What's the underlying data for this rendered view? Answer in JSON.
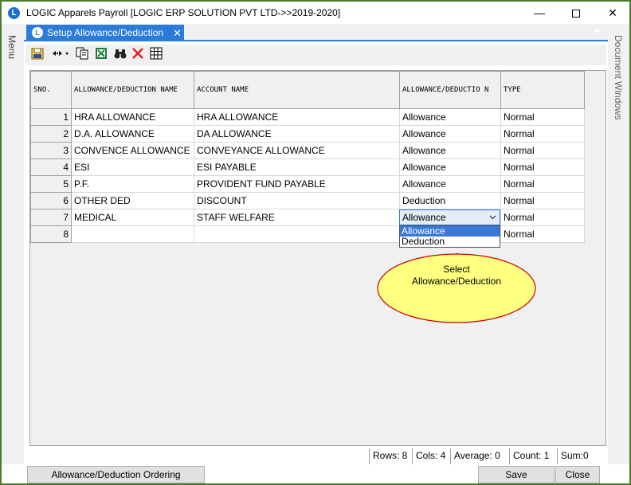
{
  "window": {
    "title": "LOGIC Apparels Payroll  [LOGIC ERP SOLUTION PVT LTD->>2019-2020]",
    "logo": "L",
    "min_label": "—",
    "close_label": "✕"
  },
  "left_panel": {
    "label": "Menu"
  },
  "right_panel": {
    "label": "Document Windows"
  },
  "tab": {
    "label": "Setup Allowance/Deduction",
    "close": "✕",
    "icon": "L"
  },
  "toolbar": {
    "icons": [
      "save-icon",
      "column-width-icon",
      "copy-icon",
      "excel-export-icon",
      "find-icon",
      "delete-icon",
      "grid-icon"
    ]
  },
  "grid": {
    "headers": {
      "sno": "SNO.",
      "name": "ALLOWANCE/DEDUCTION NAME",
      "account": "ACCOUNT NAME",
      "allowance": "ALLOWANCE/DEDUCTIO N",
      "type": "TYPE"
    },
    "rows": [
      {
        "sno": "1",
        "name": "HRA ALLOWANCE",
        "account": "HRA ALLOWANCE",
        "allowance": "Allowance",
        "type": "Normal"
      },
      {
        "sno": "2",
        "name": "D.A. ALLOWANCE",
        "account": "DA ALLOWANCE",
        "allowance": "Allowance",
        "type": "Normal"
      },
      {
        "sno": "3",
        "name": "CONVENCE ALLOWANCE",
        "account": "CONVEYANCE ALLOWANCE",
        "allowance": "Allowance",
        "type": "Normal"
      },
      {
        "sno": "4",
        "name": "ESI",
        "account": "ESI PAYABLE",
        "allowance": "Allowance",
        "type": "Normal"
      },
      {
        "sno": "5",
        "name": "P.F.",
        "account": "PROVIDENT FUND PAYABLE",
        "allowance": "Allowance",
        "type": "Normal"
      },
      {
        "sno": "6",
        "name": "OTHER DED",
        "account": "DISCOUNT",
        "allowance": "Deduction",
        "type": "Normal"
      },
      {
        "sno": "7",
        "name": "MEDICAL",
        "account": "STAFF WELFARE",
        "allowance": "",
        "type": "Normal"
      },
      {
        "sno": "8",
        "name": "",
        "account": "",
        "allowance": "",
        "type": "Normal"
      }
    ]
  },
  "combo": {
    "value": "Allowance",
    "options": [
      "Allowance",
      "Deduction"
    ],
    "selected": "Allowance"
  },
  "callout": {
    "line1": "Select",
    "line2": "Allowance/Deduction",
    "fill": "#ffff80",
    "stroke": "#d00000"
  },
  "status": {
    "rows": "Rows: 8",
    "cols": "Cols: 4",
    "average": "Average: 0",
    "count": "Count: 1",
    "sum": "Sum:0"
  },
  "buttons": {
    "ordering": "Allowance/Deduction Ordering",
    "save": "Save",
    "close": "Close"
  },
  "colors": {
    "accent": "#2b7bd8",
    "frame": "#4a7d2b"
  }
}
